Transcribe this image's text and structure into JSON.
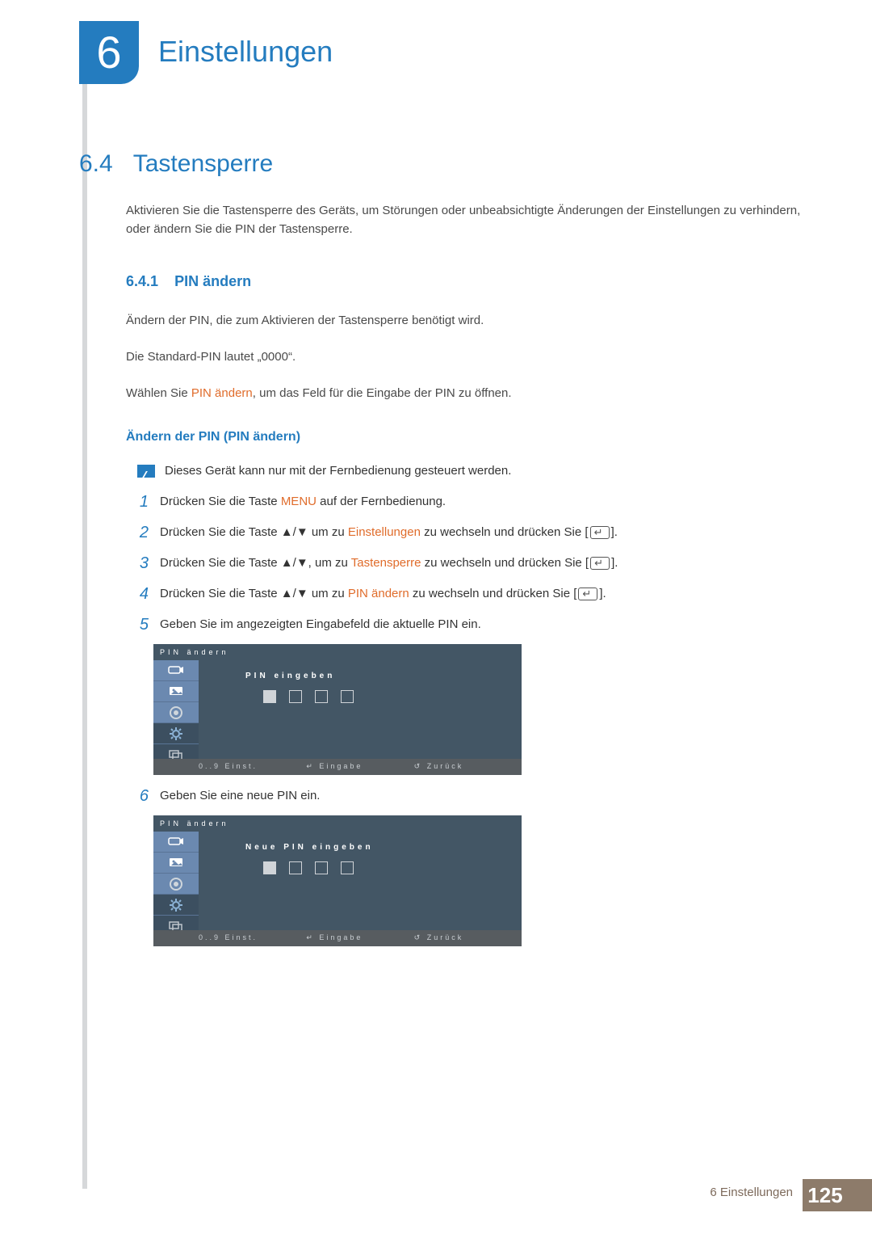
{
  "chapter": {
    "number": "6",
    "title": "Einstellungen"
  },
  "section": {
    "number": "6.4",
    "title": "Tastensperre",
    "intro": "Aktivieren Sie die Tastensperre des Geräts, um Störungen oder unbeabsichtigte Änderungen der Einstellungen zu verhindern, oder ändern Sie die PIN der Tastensperre."
  },
  "sub": {
    "number": "6.4.1",
    "title": "PIN ändern",
    "l1": "Ändern der PIN, die zum Aktivieren der Tastensperre benötigt wird.",
    "l2": "Die Standard-PIN lautet „0000“.",
    "l3a": "Wählen Sie ",
    "l3b": "PIN ändern",
    "l3c": ", um das Feld für die Eingabe der PIN zu öffnen.",
    "h2": "Ändern der PIN (PIN ändern)",
    "note": "Dieses Gerät kann nur mit der Fernbedienung gesteuert werden."
  },
  "steps": {
    "s1": {
      "n": "1",
      "a": "Drücken Sie die Taste ",
      "b": "MENU",
      "c": " auf der Fernbedienung."
    },
    "s2": {
      "n": "2",
      "a": "Drücken Sie die Taste ▲/▼ um zu ",
      "b": "Einstellungen",
      "c": " zu wechseln und drücken Sie [",
      "d": "]."
    },
    "s3": {
      "n": "3",
      "a": "Drücken Sie die Taste ▲/▼, um zu ",
      "b": "Tastensperre",
      "c": " zu wechseln und drücken Sie [",
      "d": "]."
    },
    "s4": {
      "n": "4",
      "a": "Drücken Sie die Taste ▲/▼ um zu ",
      "b": "PIN ändern",
      "c": " zu wechseln und drücken Sie [",
      "d": "]."
    },
    "s5": {
      "n": "5",
      "a": "Geben Sie im angezeigten Eingabefeld die aktuelle PIN ein."
    },
    "s6": {
      "n": "6",
      "a": "Geben Sie eine neue PIN ein."
    }
  },
  "osd": {
    "title": "PIN ändern",
    "label1": "PIN eingeben",
    "label2": "Neue PIN eingeben",
    "f1": "0..9 Einst.",
    "f2": "Eingabe",
    "f3": "Zurück"
  },
  "pagefoot": {
    "label": "6 Einstellungen",
    "page": "125"
  }
}
